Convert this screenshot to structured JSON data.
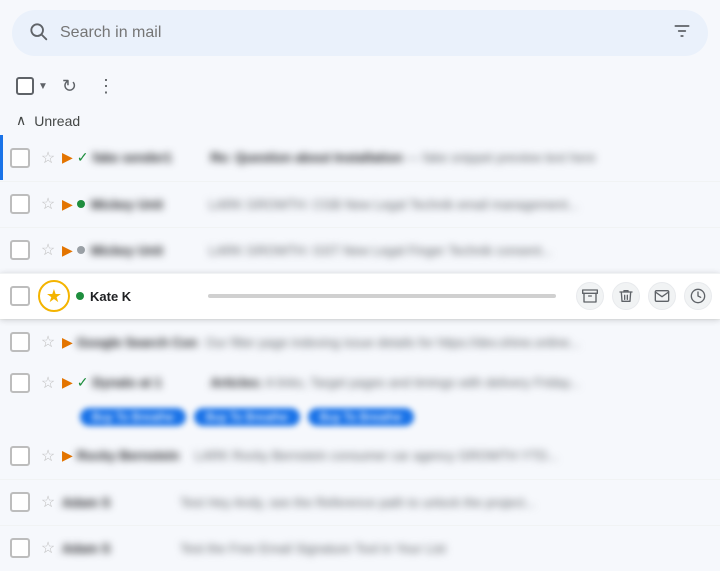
{
  "search": {
    "placeholder": "Search in mail"
  },
  "toolbar": {
    "refresh_label": "↻",
    "more_label": "⋮"
  },
  "section": {
    "title": "Unread",
    "chevron": "∧"
  },
  "rows": [
    {
      "id": "row1",
      "starred": false,
      "important": true,
      "status": "check",
      "sender": "fake sender1",
      "subject": "Re: Question about Installation",
      "snippet": "fake snippet text here for preview",
      "first": true,
      "active": false
    },
    {
      "id": "row2",
      "starred": false,
      "important": true,
      "status": "dot-green",
      "sender": "Mickey Unit",
      "subject": "",
      "snippet": "LARK GROWTH: CGB New Legal Technik email management...",
      "first": false,
      "active": false
    },
    {
      "id": "row3",
      "starred": false,
      "important": true,
      "status": "dot-gray",
      "sender": "Mickey Unit",
      "subject": "",
      "snippet": "LARK GROWTH: GST New Legal Finger Technik consent...",
      "first": false,
      "active": false
    },
    {
      "id": "row4",
      "starred": true,
      "important": false,
      "status": "dot-green",
      "sender": "Kate K",
      "subject": "",
      "snippet": "",
      "first": false,
      "active": true
    },
    {
      "id": "row5",
      "starred": false,
      "important": true,
      "status": "none",
      "sender": "Google Search Con",
      "subject": "",
      "snippet": "Our filter page indexing issue details for https://dev.shine.online...",
      "first": false,
      "active": false
    },
    {
      "id": "row6",
      "starred": false,
      "important": true,
      "status": "check",
      "sender": "Dynalo at 1",
      "subject": "Articles:",
      "snippet": "A links, Target pages and timings with delivery Friday on...",
      "first": false,
      "active": false,
      "has_chips": true
    },
    {
      "id": "row7",
      "starred": false,
      "important": true,
      "status": "none",
      "sender": "Rocky Bernstein",
      "subject": "",
      "snippet": "LARK Rocky Bernstein consumer car agency GROWTH YTD...",
      "first": false,
      "active": false
    },
    {
      "id": "row8",
      "starred": false,
      "important": false,
      "status": "none",
      "sender": "Adam S",
      "subject": "",
      "snippet": "Test Hey Andy, see the Reference path to unlock the project...",
      "first": false,
      "active": false
    },
    {
      "id": "row9",
      "starred": false,
      "important": false,
      "status": "none",
      "sender": "Adam S",
      "subject": "",
      "snippet": "Test the Free Email Signature Tool in Your List",
      "first": false,
      "active": false
    }
  ],
  "active_row_actions": [
    {
      "icon": "⬆",
      "name": "archive-icon"
    },
    {
      "icon": "🗑",
      "name": "delete-icon"
    },
    {
      "icon": "✉",
      "name": "mark-read-icon"
    },
    {
      "icon": "⏰",
      "name": "snooze-icon"
    }
  ],
  "chips": [
    "Buy To Breathe",
    "Buy To Breathe",
    "Buy To Breathe"
  ],
  "icons": {
    "search": "🔍",
    "filter": "⚙",
    "star_empty": "☆",
    "star_filled": "★",
    "important": "▶",
    "check": "✓",
    "chevron_down": "∧"
  }
}
